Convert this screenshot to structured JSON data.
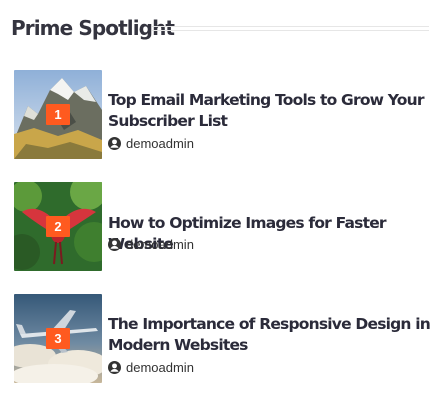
{
  "widget": {
    "title": "Prime Spotlight"
  },
  "posts": [
    {
      "rank": "1",
      "title": "Top Email Marketing Tools to Grow Your Subscriber List",
      "author": "demoadmin",
      "author_icon": "user-icon",
      "image": "mountain-peaks-photo"
    },
    {
      "rank": "2",
      "title": "How to Optimize Images for Faster Website",
      "author": "demoadmin",
      "author_icon": "user-icon",
      "image": "red-bird-photo"
    },
    {
      "rank": "3",
      "title": "The Importance of Responsive Design in Modern Websites",
      "author": "demoadmin",
      "author_icon": "user-icon",
      "image": "airplane-sky-photo"
    }
  ],
  "colors": {
    "rank_badge": "#ff5a1f",
    "title_text": "#2b2b3a",
    "divider": "#e6e6e6"
  }
}
